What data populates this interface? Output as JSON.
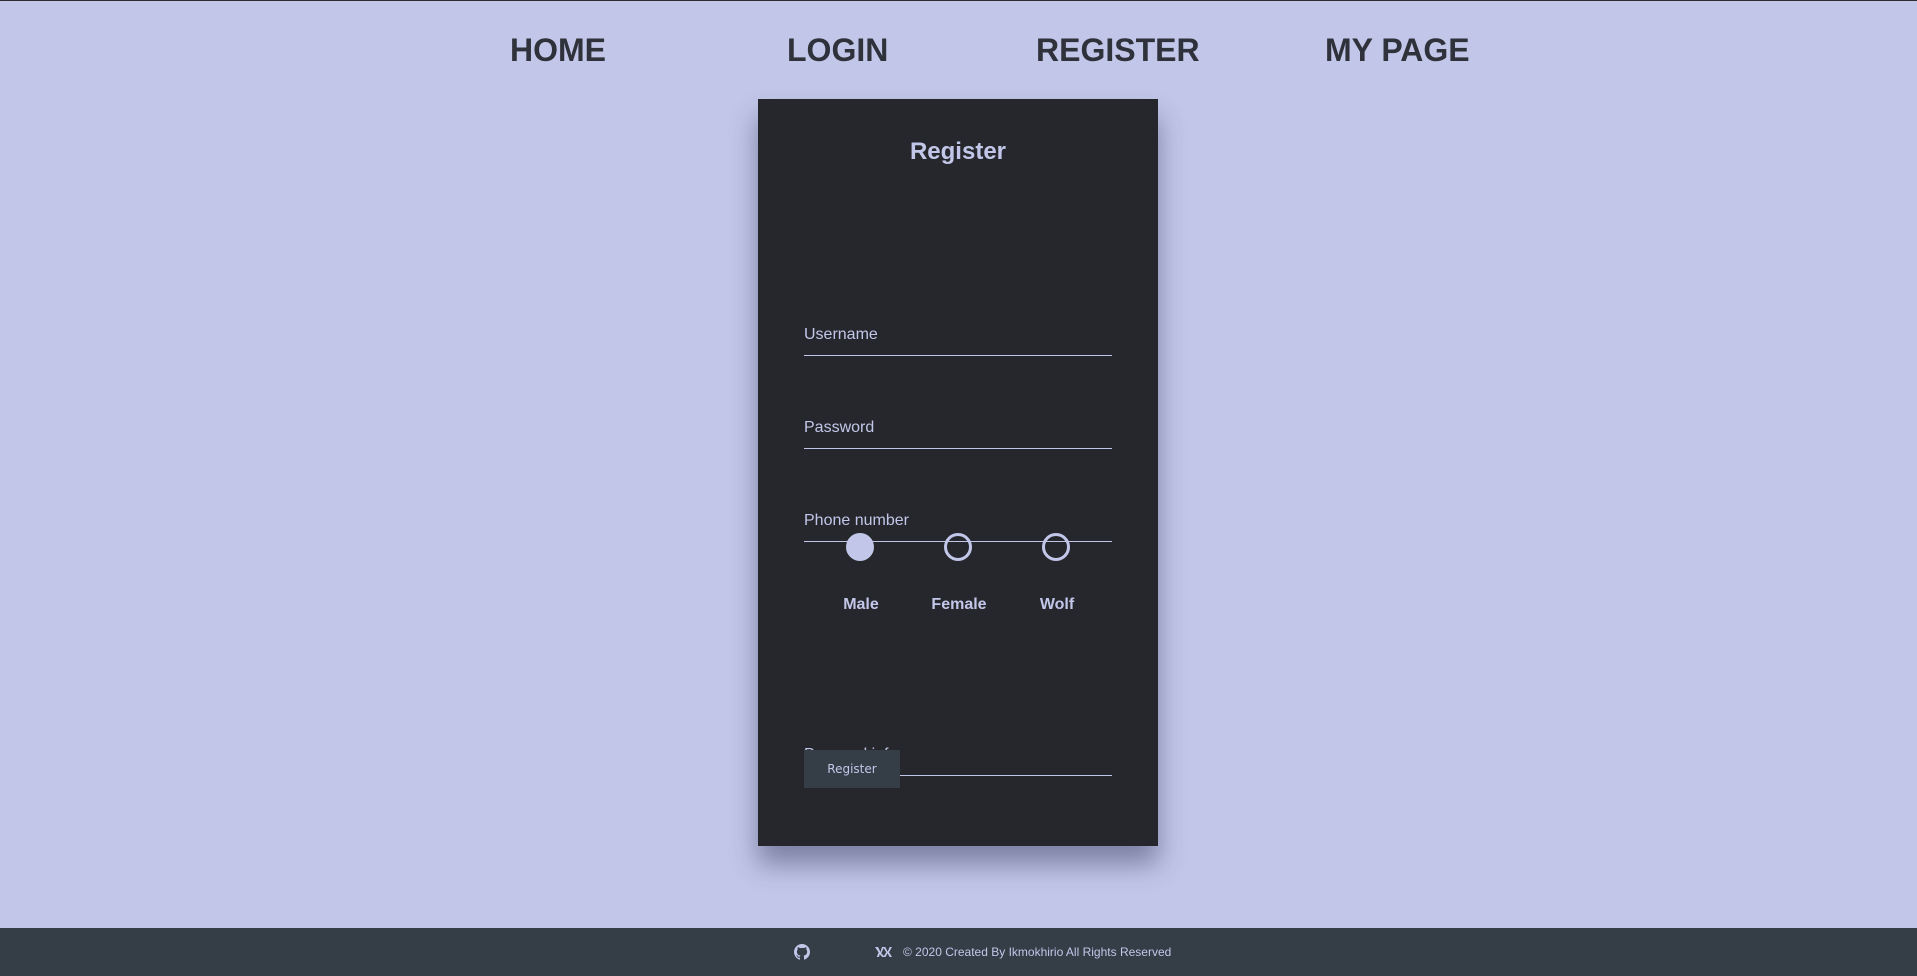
{
  "nav": {
    "home": "HOME",
    "login": "LOGIN",
    "register": "REGISTER",
    "my_page": "MY PAGE"
  },
  "form": {
    "title": "Register",
    "username_placeholder": "Username",
    "password_placeholder": "Password",
    "phone_placeholder": "Phone number",
    "personal_info_placeholder": "Personal info",
    "gender_options": [
      {
        "label": "Male",
        "checked": true
      },
      {
        "label": "Female",
        "checked": false
      },
      {
        "label": "Wolf",
        "checked": false
      }
    ],
    "submit_label": "Register"
  },
  "footer": {
    "icons": [
      "github-icon",
      "vk-icon"
    ],
    "copyright": "© 2020 Created By Ikmokhirio All Rights Reserved"
  },
  "colors": {
    "background": "#c2c7e9",
    "card": "#26272d",
    "footer": "#353d47",
    "accent": "#c2c7e9",
    "nav_text": "#2f323a"
  }
}
